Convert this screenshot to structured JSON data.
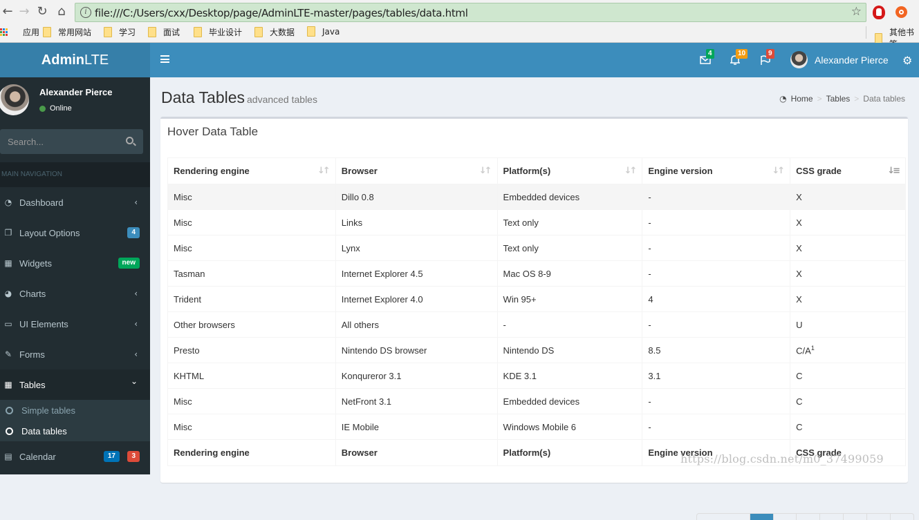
{
  "browser": {
    "url": "file:///C:/Users/cxx/Desktop/page/AdminLTE-master/pages/tables/data.html",
    "bookmarks": [
      "应用",
      "常用网站",
      "学习",
      "面试",
      "毕业设计",
      "大数据",
      "Java"
    ],
    "other_bookmarks": "其他书签"
  },
  "header": {
    "logo_bold": "Admin",
    "logo_light": "LTE",
    "messages_count": "4",
    "notifications_count": "10",
    "tasks_count": "9",
    "user_name": "Alexander Pierce",
    "colors": {
      "primary": "#3c8dbc",
      "logo_bg": "#367fa9",
      "green": "#00a65a",
      "yellow": "#f39c12",
      "red": "#dd4b39"
    }
  },
  "sidebar": {
    "user_name": "Alexander Pierce",
    "status": "Online",
    "search_placeholder": "Search...",
    "nav_header": "MAIN NAVIGATION",
    "items": [
      {
        "label": "Dashboard",
        "icon": "dashboard-icon",
        "chevron": "‹"
      },
      {
        "label": "Layout Options",
        "icon": "files-icon",
        "badge": "4",
        "badge_color": "#3c8dbc"
      },
      {
        "label": "Widgets",
        "icon": "th-icon",
        "badge": "new",
        "badge_color": "#00a65a"
      },
      {
        "label": "Charts",
        "icon": "pie-chart-icon",
        "chevron": "‹"
      },
      {
        "label": "UI Elements",
        "icon": "laptop-icon",
        "chevron": "‹"
      },
      {
        "label": "Forms",
        "icon": "edit-icon",
        "chevron": "‹"
      },
      {
        "label": "Tables",
        "icon": "table-icon",
        "chevron": "⌄",
        "active": true
      },
      {
        "label": "Calendar",
        "icon": "calendar-icon",
        "badges": [
          "17",
          "3"
        ]
      }
    ],
    "tables_submenu": [
      "Simple tables",
      "Data tables"
    ]
  },
  "content": {
    "title": "Data Tables",
    "subtitle": "advanced tables",
    "breadcrumb": [
      "Home",
      "Tables",
      "Data tables"
    ],
    "box_title": "Hover Data Table",
    "table": {
      "columns": [
        "Rendering engine",
        "Browser",
        "Platform(s)",
        "Engine version",
        "CSS grade"
      ],
      "rows": [
        [
          "Misc",
          "Dillo 0.8",
          "Embedded devices",
          "-",
          "X"
        ],
        [
          "Misc",
          "Links",
          "Text only",
          "-",
          "X"
        ],
        [
          "Misc",
          "Lynx",
          "Text only",
          "-",
          "X"
        ],
        [
          "Tasman",
          "Internet Explorer 4.5",
          "Mac OS 8-9",
          "-",
          "X"
        ],
        [
          "Trident",
          "Internet Explorer 4.0",
          "Win 95+",
          "4",
          "X"
        ],
        [
          "Other browsers",
          "All others",
          "-",
          "-",
          "U"
        ],
        [
          "Presto",
          "Nintendo DS browser",
          "Nintendo DS",
          "8.5",
          "C/A"
        ],
        [
          "KHTML",
          "Konqureror 3.1",
          "KDE 3.1",
          "3.1",
          "C"
        ],
        [
          "Misc",
          "NetFront 3.1",
          "Embedded devices",
          "-",
          "C"
        ],
        [
          "Misc",
          "IE Mobile",
          "Windows Mobile 6",
          "-",
          "C"
        ]
      ],
      "footnote_marker": "1"
    }
  },
  "watermark": "https://blog.csdn.net/m0_37499059"
}
